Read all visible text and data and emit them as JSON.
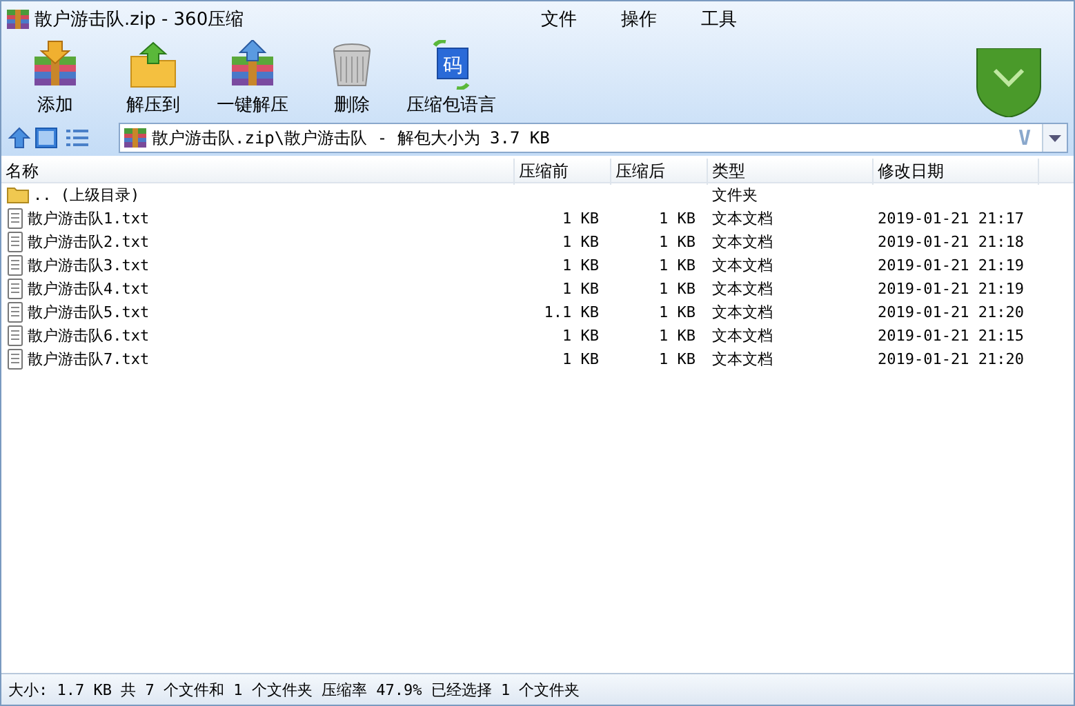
{
  "window": {
    "title": "散户游击队.zip - 360压缩"
  },
  "menu": [
    "文件",
    "操作",
    "工具"
  ],
  "toolbar": [
    {
      "label": "添加",
      "kind": "add"
    },
    {
      "label": "解压到",
      "kind": "extract"
    },
    {
      "label": "一键解压",
      "kind": "quick"
    },
    {
      "label": "删除",
      "kind": "delete"
    },
    {
      "label": "压缩包语言",
      "kind": "language",
      "glyph": "码"
    }
  ],
  "address": {
    "value": "散户游击队.zip\\散户游击队 - 解包大小为 3.7 KB",
    "suffix": "V"
  },
  "table": {
    "columns": [
      "名称",
      "压缩前",
      "压缩后",
      "类型",
      "修改日期"
    ],
    "rows": [
      {
        "kind": "folder",
        "name": ".. (上级目录)",
        "before": "",
        "after": "",
        "type": "文件夹",
        "date": ""
      },
      {
        "kind": "file",
        "name": "散户游击队1.txt",
        "before": "1 KB",
        "after": "1 KB",
        "type": "文本文档",
        "date": "2019-01-21 21:17"
      },
      {
        "kind": "file",
        "name": "散户游击队2.txt",
        "before": "1 KB",
        "after": "1 KB",
        "type": "文本文档",
        "date": "2019-01-21 21:18"
      },
      {
        "kind": "file",
        "name": "散户游击队3.txt",
        "before": "1 KB",
        "after": "1 KB",
        "type": "文本文档",
        "date": "2019-01-21 21:19"
      },
      {
        "kind": "file",
        "name": "散户游击队4.txt",
        "before": "1 KB",
        "after": "1 KB",
        "type": "文本文档",
        "date": "2019-01-21 21:19"
      },
      {
        "kind": "file",
        "name": "散户游击队5.txt",
        "before": "1.1 KB",
        "after": "1 KB",
        "type": "文本文档",
        "date": "2019-01-21 21:20"
      },
      {
        "kind": "file",
        "name": "散户游击队6.txt",
        "before": "1 KB",
        "after": "1 KB",
        "type": "文本文档",
        "date": "2019-01-21 21:15"
      },
      {
        "kind": "file",
        "name": "散户游击队7.txt",
        "before": "1 KB",
        "after": "1 KB",
        "type": "文本文档",
        "date": "2019-01-21 21:20"
      }
    ]
  },
  "status_bar": "大小: 1.7 KB 共 7 个文件和 1 个文件夹 压缩率 47.9% 已经选择 1 个文件夹"
}
